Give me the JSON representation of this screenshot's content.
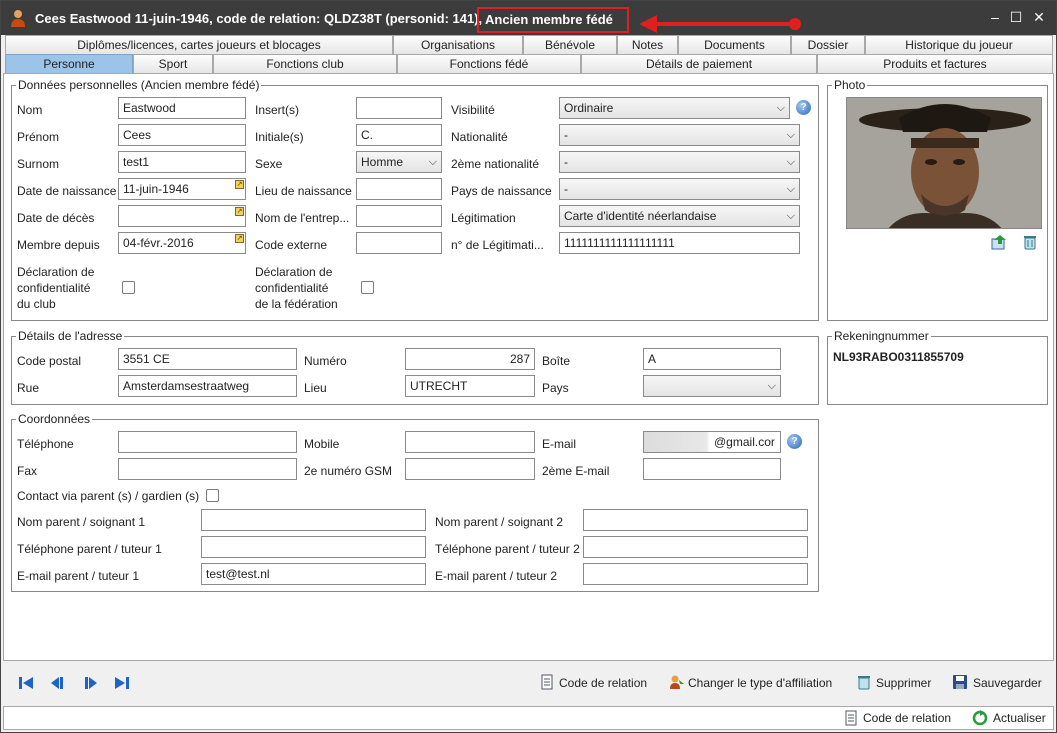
{
  "window": {
    "title": "Cees Eastwood 11-juin-1946, code de relation: QLDZ38T (personid: 141),",
    "status_highlight": "Ancien membre fédé",
    "accent_color": "#9cc4e8",
    "highlight_color": "#e02020"
  },
  "tabs_row1": [
    "Diplômes/licences, cartes joueurs et blocages",
    "Organisations",
    "Bénévole",
    "Notes",
    "Documents",
    "Dossier",
    "Historique du joueur"
  ],
  "tabs_row2": [
    "Personne",
    "Sport",
    "Fonctions club",
    "Fonctions fédé",
    "Détails de paiement",
    "Produits et factures"
  ],
  "personal": {
    "section_title": "Données personnelles (Ancien membre fédé)",
    "nom_label": "Nom",
    "nom_value": "Eastwood",
    "prenom_label": "Prénom",
    "prenom_value": "Cees",
    "surnom_label": "Surnom",
    "surnom_value": "test1",
    "naissance_label": "Date de naissance",
    "naissance_value": "11-juin-1946",
    "deces_label": "Date de décès",
    "deces_value": "",
    "membre_label": "Membre depuis",
    "membre_value": "04-févr.-2016",
    "conf_club_label": [
      "Déclaration de",
      "confidentialité",
      "du club"
    ],
    "insert_label": "Insert(s)",
    "insert_value": "",
    "initiales_label": "Initiale(s)",
    "initiales_value": "C.",
    "sexe_label": "Sexe",
    "sexe_value": "Homme",
    "lieu_naissance_label": "Lieu de naissance",
    "lieu_naissance_value": "",
    "entreprise_label": "Nom de l'entrep...",
    "entreprise_value": "",
    "code_externe_label": "Code externe",
    "code_externe_value": "",
    "conf_fed_label": [
      "Déclaration de",
      "confidentialité",
      "de la fédération"
    ],
    "visibilite_label": "Visibilité",
    "visibilite_value": "Ordinaire",
    "nationalite_label": "Nationalité",
    "nationalite_value": "-",
    "nationalite2_label": "2ème nationalité",
    "nationalite2_value": "-",
    "pays_naissance_label": "Pays de naissance",
    "pays_naissance_value": "-",
    "legitimation_label": "Légitimation",
    "legitimation_value": "Carte d'identité néerlandaise",
    "no_legitimation_label": "n° de Légitimati...",
    "no_legitimation_value": "1111111111111111111"
  },
  "photo": {
    "title": "Photo"
  },
  "address": {
    "section_title": "Détails de l'adresse",
    "code_postal_label": "Code postal",
    "code_postal_value": "3551 CE",
    "rue_label": "Rue",
    "rue_value": "Amsterdamsestraatweg",
    "numero_label": "Numéro",
    "numero_value": "287",
    "lieu_label": "Lieu",
    "lieu_value": "UTRECHT",
    "boite_label": "Boîte",
    "boite_value": "A",
    "pays_label": "Pays",
    "pays_value": ""
  },
  "bank": {
    "title": "Rekeningnummer",
    "value": "NL93RABO0311855709"
  },
  "contact": {
    "section_title": "Coordonnées",
    "telephone_label": "Téléphone",
    "telephone_value": "",
    "fax_label": "Fax",
    "fax_value": "",
    "mobile_label": "Mobile",
    "mobile_value": "",
    "gsm2_label": "2e numéro GSM",
    "gsm2_value": "",
    "email_label": "E-mail",
    "email_value": "@gmail.cor",
    "email2_label": "2ème E-mail",
    "email2_value": "",
    "parent_contact_label": "Contact via parent (s) / gardien (s)",
    "parent1_name_label": "Nom parent / soignant 1",
    "parent1_name_value": "",
    "parent1_phone_label": "Téléphone parent / tuteur 1",
    "parent1_phone_value": "",
    "parent1_email_label": "E-mail parent / tuteur 1",
    "parent1_email_value": "test@test.nl",
    "parent2_name_label": "Nom parent / soignant 2",
    "parent2_name_value": "",
    "parent2_phone_label": "Téléphone parent / tuteur 2",
    "parent2_phone_value": "",
    "parent2_email_label": "E-mail parent / tuteur 2",
    "parent2_email_value": ""
  },
  "actions": {
    "code_relation": "Code de relation",
    "changer_type": "Changer le type d'affiliation",
    "supprimer": "Supprimer",
    "sauvegarder": "Sauvegarder"
  },
  "statusbar": {
    "code_relation": "Code de relation",
    "actualiser": "Actualiser"
  }
}
